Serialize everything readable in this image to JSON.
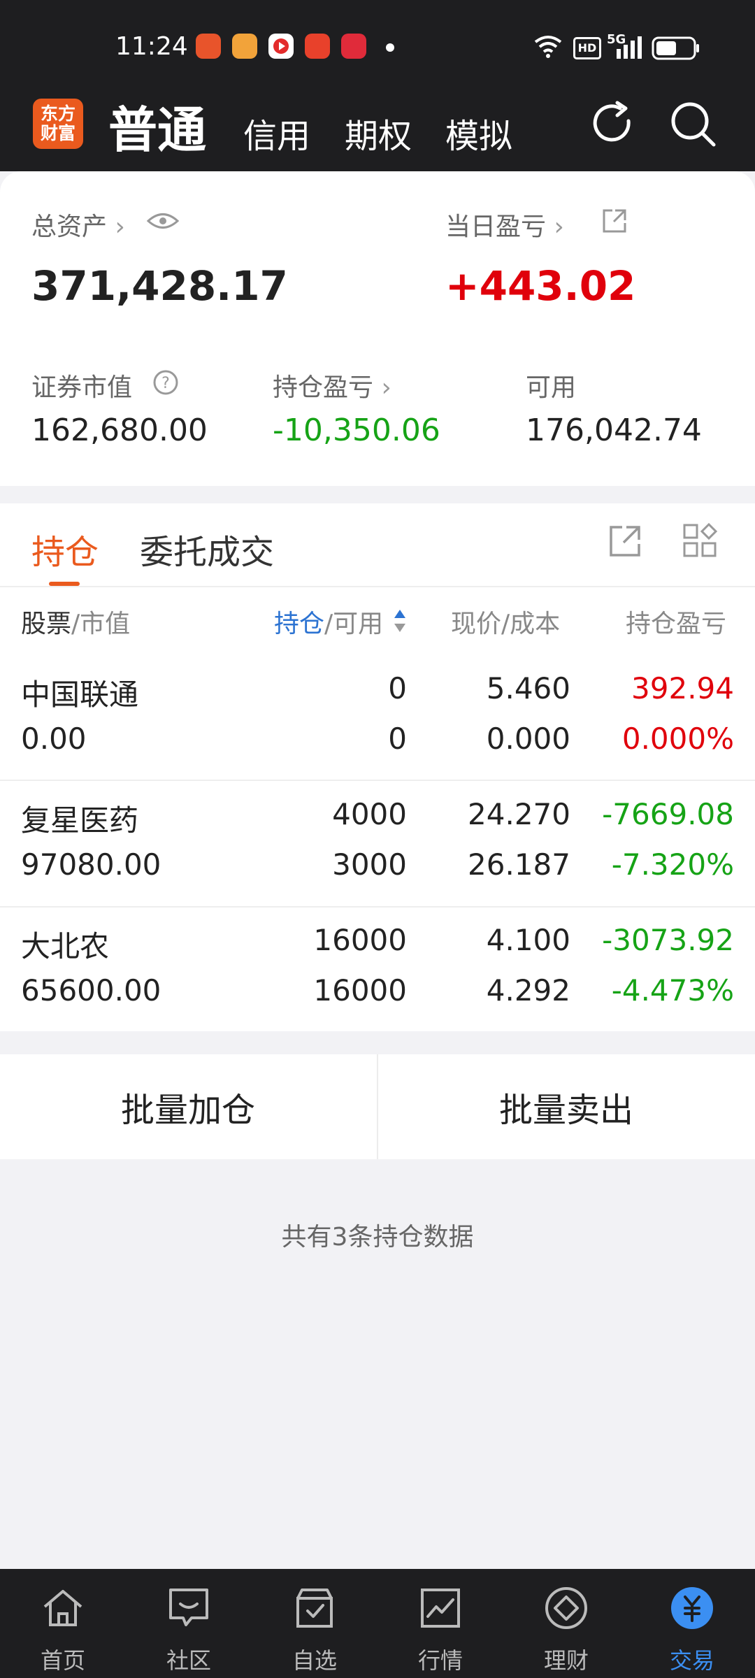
{
  "status_bar": {
    "time": "11:24",
    "hd_badge": "HD",
    "network": "5G"
  },
  "header": {
    "logo_text_line1": "东方",
    "logo_text_line2": "财富",
    "tabs": [
      "普通",
      "信用",
      "期权",
      "模拟"
    ],
    "active_tab": "普通"
  },
  "assets": {
    "total_assets_label": "总资产",
    "total_assets_value": "371,428.17",
    "daily_pl_label": "当日盈亏",
    "daily_pl_value": "+443.02",
    "securities_mv_label": "证券市值",
    "securities_mv_value": "162,680.00",
    "position_pl_label": "持仓盈亏",
    "position_pl_value": "-10,350.06",
    "available_label": "可用",
    "available_value": "176,042.74"
  },
  "positions": {
    "tab_hold": "持仓",
    "tab_orders": "委托成交",
    "columns": {
      "stock": "股票",
      "stock_sub": "/市值",
      "hold": "持仓",
      "hold_sub": "/可用",
      "price": "现价/成本",
      "pl": "持仓盈亏"
    },
    "rows": [
      {
        "name": "中国联通",
        "market_value": "0.00",
        "hold": "0",
        "available": "0",
        "price": "5.460",
        "cost": "0.000",
        "pl": "392.94",
        "pl_pct": "0.000%"
      },
      {
        "name": "复星医药",
        "market_value": "97080.00",
        "hold": "4000",
        "available": "3000",
        "price": "24.270",
        "cost": "26.187",
        "pl": "-7669.08",
        "pl_pct": "-7.320%"
      },
      {
        "name": "大北农",
        "market_value": "65600.00",
        "hold": "16000",
        "available": "16000",
        "price": "4.100",
        "cost": "4.292",
        "pl": "-3073.92",
        "pl_pct": "-4.473%"
      }
    ]
  },
  "actions": {
    "batch_add": "批量加仓",
    "batch_sell": "批量卖出"
  },
  "note": "共有3条持仓数据",
  "bottom_nav": [
    {
      "label": "首页",
      "icon": "home-icon"
    },
    {
      "label": "社区",
      "icon": "chat-icon"
    },
    {
      "label": "自选",
      "icon": "watchlist-icon"
    },
    {
      "label": "行情",
      "icon": "chart-icon"
    },
    {
      "label": "理财",
      "icon": "diamond-icon"
    },
    {
      "label": "交易",
      "icon": "trade-yen-icon"
    }
  ],
  "colors": {
    "accent": "#ea5a1e",
    "up": "#e0000b",
    "down": "#16a316",
    "nav_active": "#3b8ff2"
  }
}
